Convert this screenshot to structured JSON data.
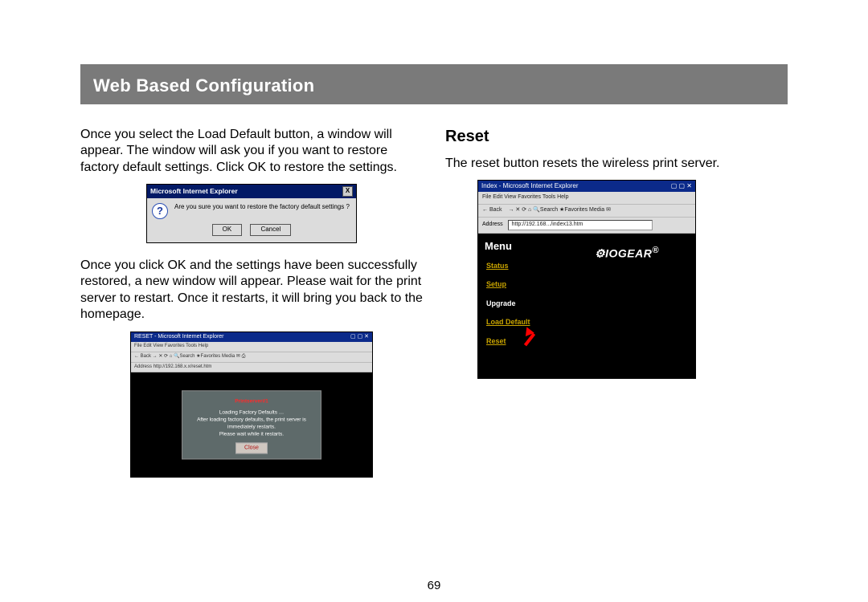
{
  "header": {
    "title": "Web Based Configuration"
  },
  "left": {
    "para1": "Once you select the Load Default button, a window will appear. The window will ask you if you want to restore factory default settings.  Click OK to restore the settings.",
    "dlg1": {
      "title": "Microsoft Internet Explorer",
      "close": "X",
      "msg": "Are you sure you want to restore the factory default settings ?",
      "ok": "OK",
      "cancel": "Cancel"
    },
    "para2": "Once you click OK and the settings have been successfully restored, a new window will appear. Please wait for the print server to restart. Once it restarts, it will bring you back to the homepage.",
    "dlg2": {
      "title": "RESET - Microsoft Internet Explorer",
      "menubar": "File   Edit   View   Favorites   Tools   Help",
      "toolbar": "← Back  →  ✕  ⟳  ⌂  🔍Search  ★Favorites  Media  ✉  ⎙",
      "addr_label": "Address",
      "addr_url": "http://192.168.x.x/reset.htm",
      "warn": "Printserver#1",
      "line1": "Loading Factory Defaults …",
      "line2": "After loading factory defaults, the print server is immediately restarts.",
      "line3": "Please wait while it restarts.",
      "close_btn": "Close"
    }
  },
  "right": {
    "subhead": "Reset",
    "para": "The reset button resets the wireless print server.",
    "fig": {
      "title": "Index - Microsoft Internet Explorer",
      "menubar": "File   Edit   View   Favorites   Tools   Help",
      "toolbar_back": "← Back",
      "toolbar_rest": "→  ✕  ⟳  ⌂  🔍Search  ★Favorites  Media  ✉",
      "addr_label": "Address",
      "addr_url": "http://192.168.../index13.htm",
      "menu_title": "Menu",
      "items": {
        "status": "Status",
        "setup": "Setup",
        "upgrade": "Upgrade",
        "load_default": "Load Default",
        "reset": "Reset"
      },
      "brand": "IOGEAR",
      "brand_tm": "®"
    }
  },
  "page_number": "69"
}
